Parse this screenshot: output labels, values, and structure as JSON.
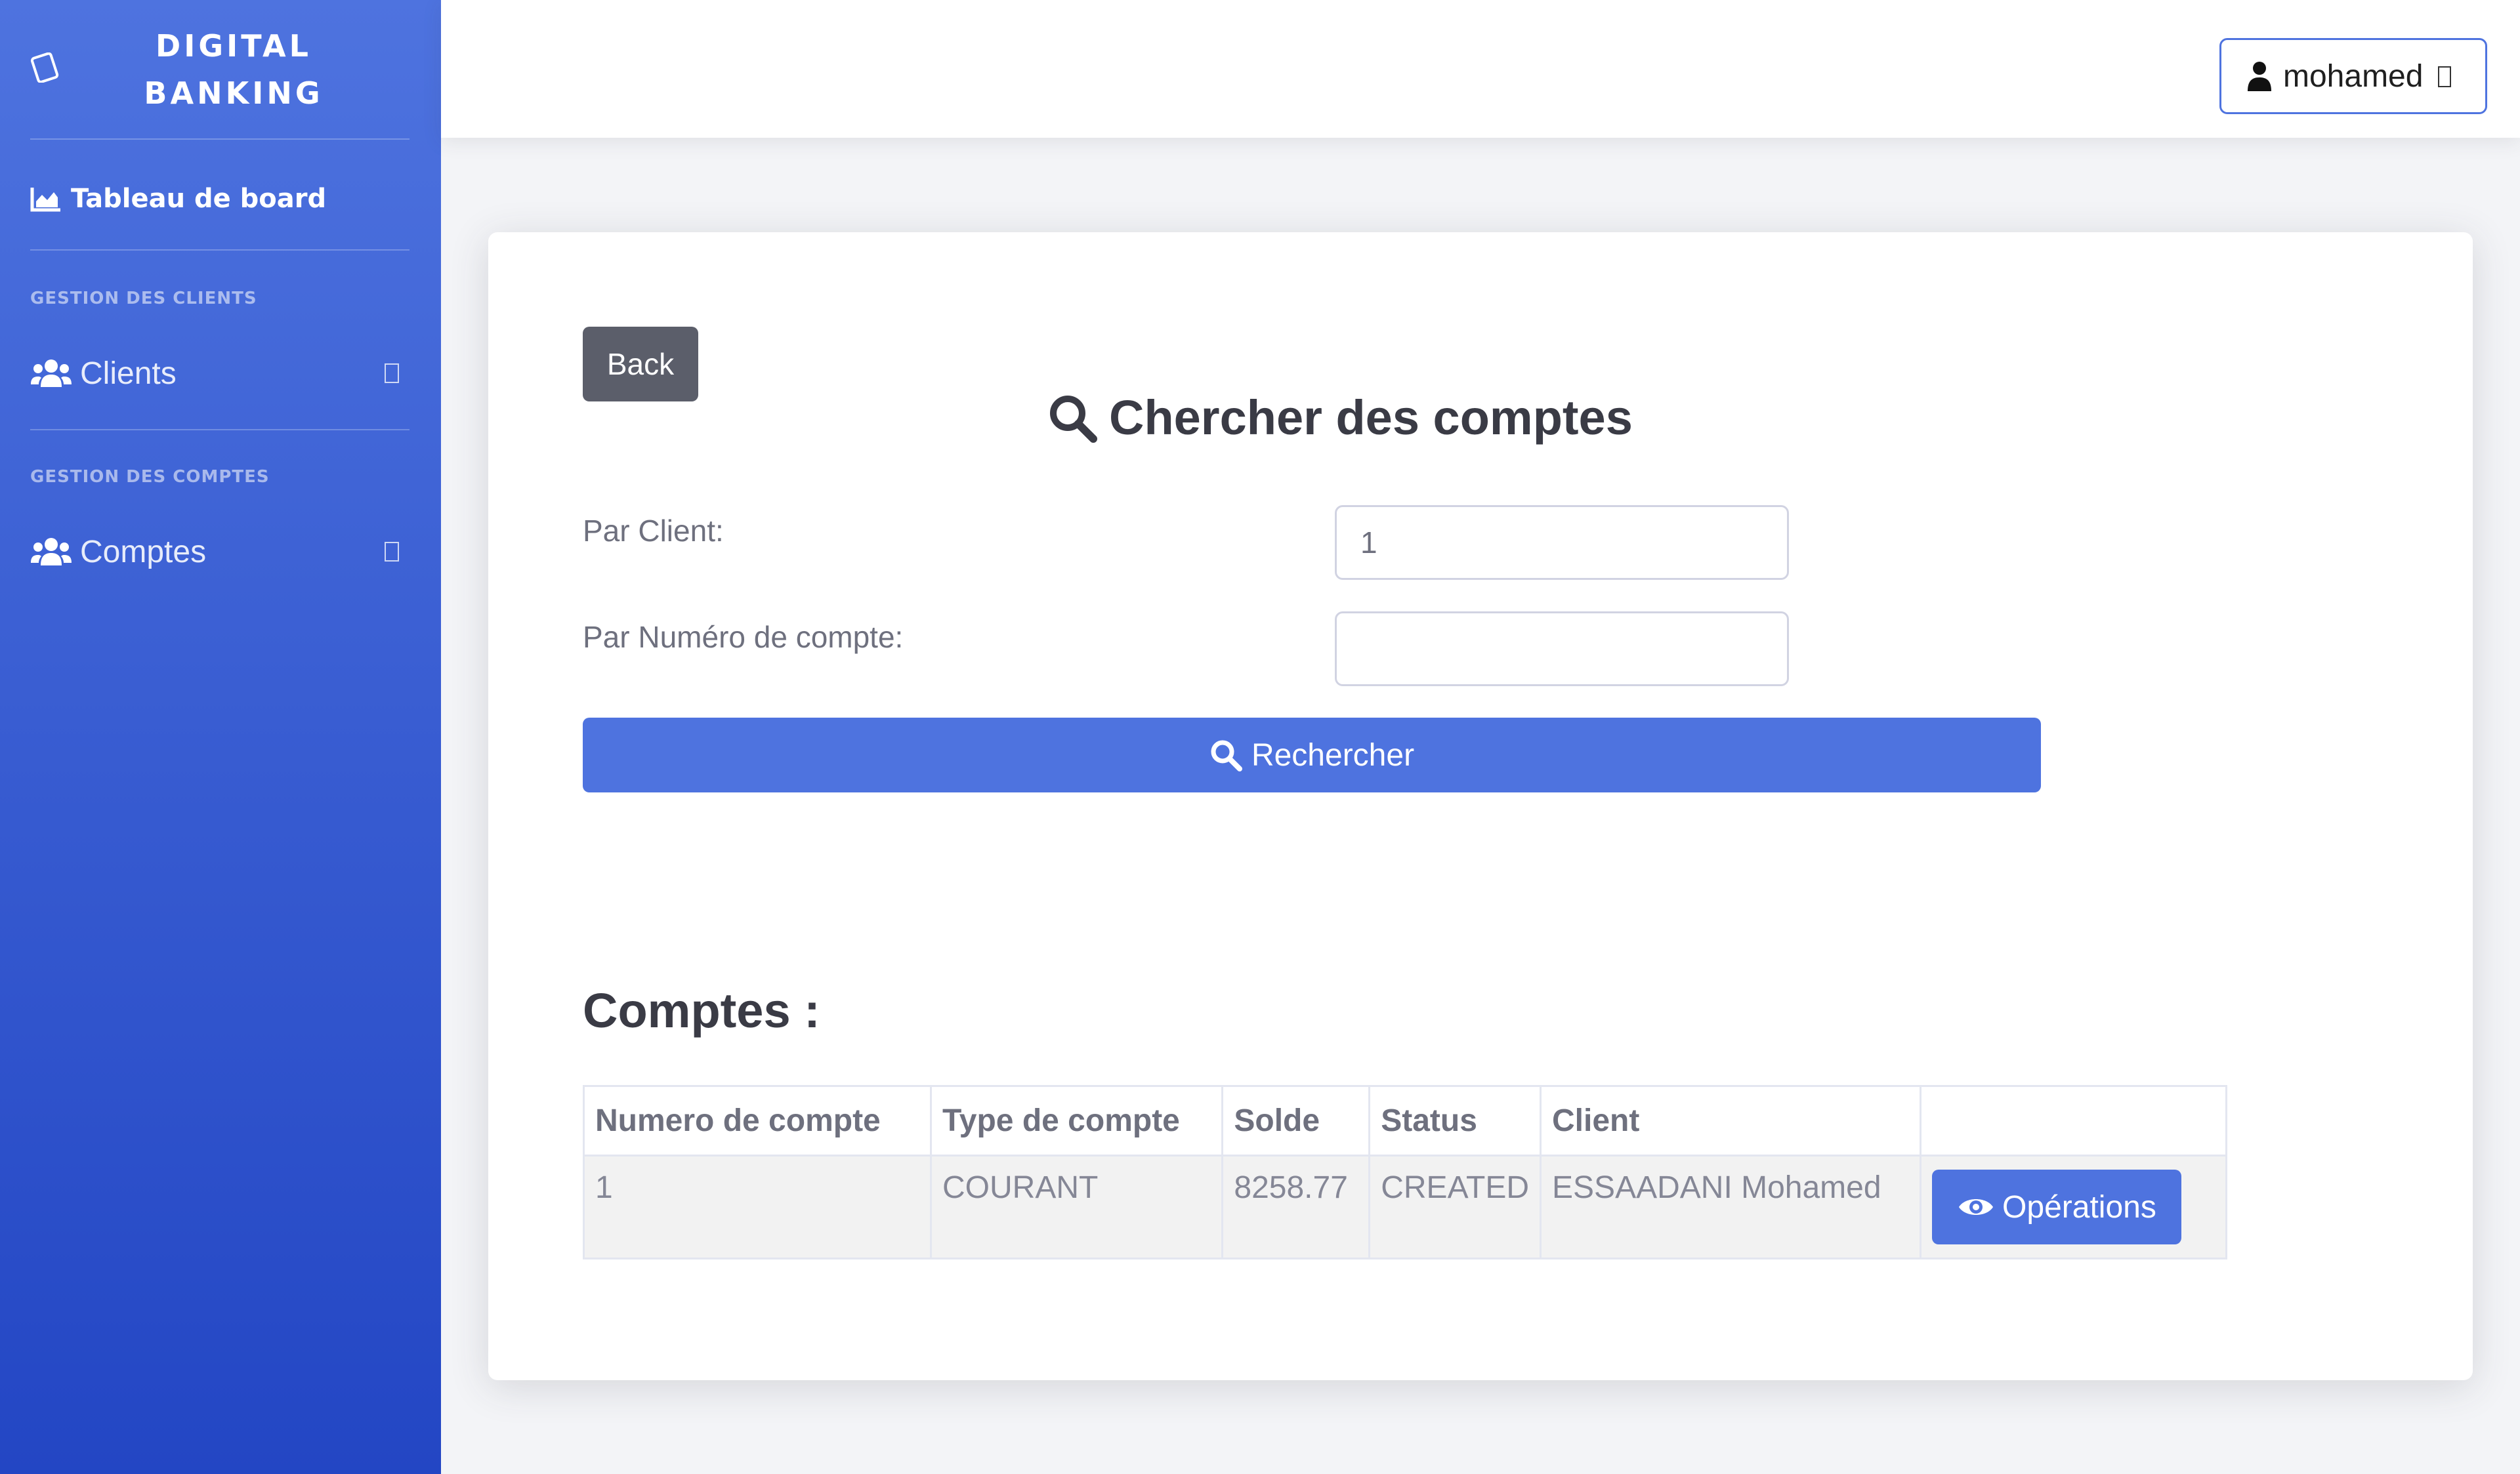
{
  "sidebar": {
    "brand": "DIGITAL\nBANKING",
    "dashboard_label": "Tableau de board",
    "sections": [
      {
        "heading": "GESTION DES CLIENTS",
        "item_label": "Clients"
      },
      {
        "heading": "GESTION DES COMPTES",
        "item_label": "Comptes"
      }
    ]
  },
  "topbar": {
    "user_name": "mohamed"
  },
  "search": {
    "back_label": "Back",
    "title": "Chercher des comptes",
    "client_label": "Par Client:",
    "client_value": "1",
    "account_label": "Par Numéro de compte:",
    "account_value": "",
    "submit_label": "Rechercher"
  },
  "results": {
    "title": "Comptes :",
    "columns": [
      "Numero de compte",
      "Type de compte",
      "Solde",
      "Status",
      "Client",
      ""
    ],
    "rows": [
      {
        "numero": "1",
        "type": "COURANT",
        "solde": "8258.77",
        "status": "CREATED",
        "client": "ESSAADANI Mohamed",
        "action_label": "Opérations"
      }
    ]
  },
  "colors": {
    "primary": "#4e73df",
    "sidebar_bottom": "#2346c4",
    "secondary": "#5b5e6a"
  },
  "icons": [
    "tablet-icon",
    "chart-area-icon",
    "users-icon",
    "user-icon",
    "search-icon",
    "eye-icon"
  ]
}
